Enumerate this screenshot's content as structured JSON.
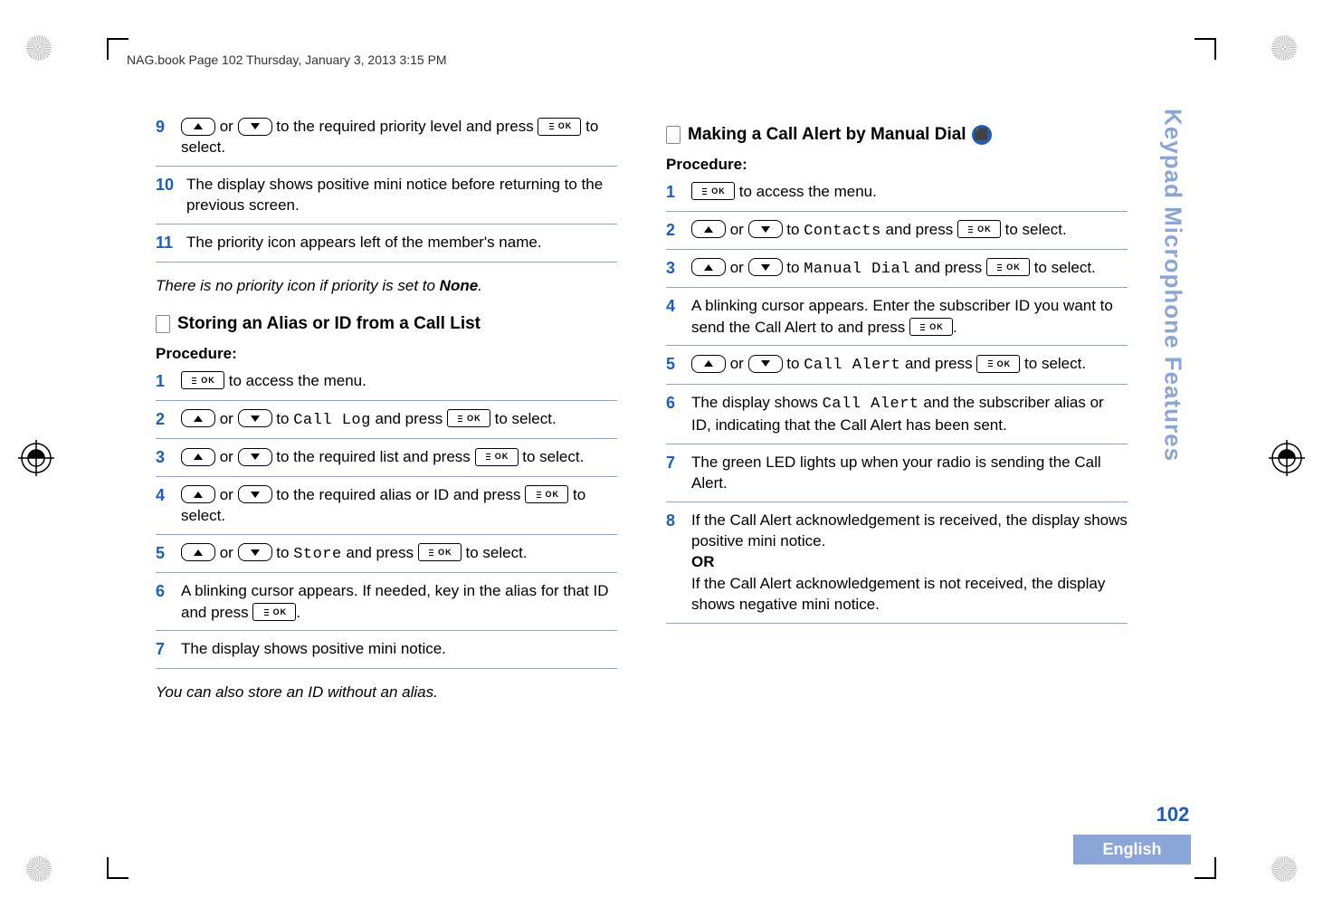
{
  "header": "NAG.book  Page 102  Thursday, January 3, 2013  3:15 PM",
  "sidebar_text": "Keypad Microphone Features",
  "page_number": "102",
  "language_label": "English",
  "button_ok": "OK",
  "left": {
    "s9": {
      "n": "9",
      "t1": " or ",
      "t2": " to the required priority level and press ",
      "t3": " to select."
    },
    "s10": {
      "n": "10",
      "t": "The display shows positive mini notice before returning to the previous screen."
    },
    "s11": {
      "n": "11",
      "t": "The priority icon appears left of the member's name."
    },
    "note1_a": "There is no priority icon if priority is set to ",
    "note1_b": "None",
    "note1_c": ".",
    "sect1": "Storing an Alias or ID from a Call List",
    "proc": "Procedure:",
    "p1": {
      "n": "1",
      "t": " to access the menu."
    },
    "p2": {
      "n": "2",
      "t1": " or ",
      "t2": " to ",
      "mono": "Call Log",
      "t3": " and press ",
      "t4": " to select."
    },
    "p3": {
      "n": "3",
      "t1": " or ",
      "t2": " to the required list and press ",
      "t3": " to select."
    },
    "p4": {
      "n": "4",
      "t1": " or ",
      "t2": " to the required alias or ID and press ",
      "t3": " to select."
    },
    "p5": {
      "n": "5",
      "t1": " or ",
      "t2": " to ",
      "mono": "Store",
      "t3": " and press ",
      "t4": " to select."
    },
    "p6": {
      "n": "6",
      "t1": "A blinking cursor appears. If needed, key in the alias for that ID and press ",
      "t2": "."
    },
    "p7": {
      "n": "7",
      "t": "The display shows positive mini notice."
    },
    "note2": "You can also store an ID without an alias."
  },
  "right": {
    "sect2": "Making a Call Alert by Manual Dial",
    "proc": "Procedure:",
    "r1": {
      "n": "1",
      "t": " to access the menu."
    },
    "r2": {
      "n": "2",
      "t1": " or ",
      "t2": " to ",
      "mono": "Contacts",
      "t3": " and press ",
      "t4": " to select."
    },
    "r3": {
      "n": "3",
      "t1": " or ",
      "t2": " to ",
      "mono": "Manual Dial",
      "t3": " and press ",
      "t4": " to select."
    },
    "r4": {
      "n": "4",
      "t1": "A blinking cursor appears. Enter the subscriber ID you want to send the Call Alert to and press ",
      "t2": "."
    },
    "r5": {
      "n": "5",
      "t1": " or ",
      "t2": " to ",
      "mono": "Call Alert",
      "t3": " and press ",
      "t4": " to select."
    },
    "r6": {
      "n": "6",
      "t1": "The display shows ",
      "mono": "Call Alert",
      "t2": " and the subscriber alias or ID, indicating that the Call Alert has been sent."
    },
    "r7": {
      "n": "7",
      "t": "The green LED lights up when your radio is sending the Call Alert."
    },
    "r8": {
      "n": "8",
      "t1": "If the Call Alert acknowledgement is received, the display shows positive mini notice.",
      "or": "OR",
      "t2": "If the Call Alert acknowledgement is not received, the display shows negative mini notice."
    }
  }
}
